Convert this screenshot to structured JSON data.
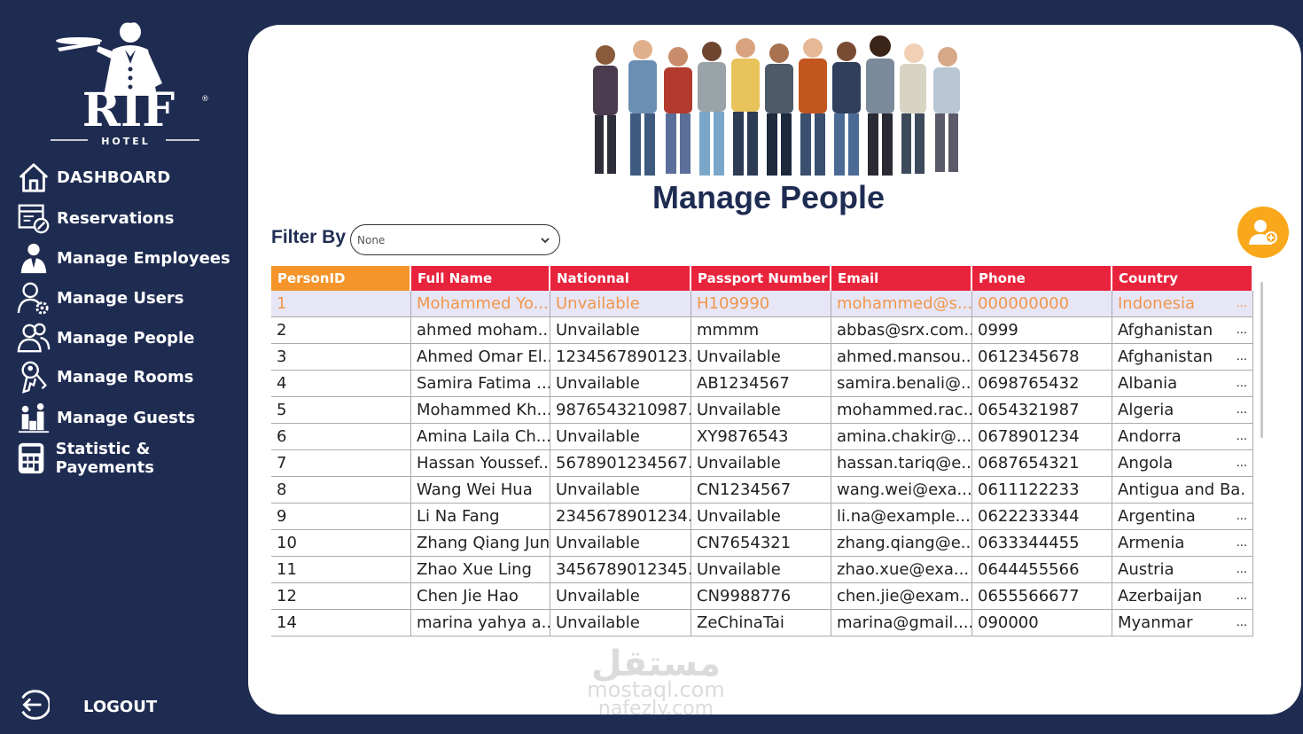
{
  "sidebar": {
    "logo": {
      "brand": "RIF",
      "sub": "HOTEL",
      "mark": "®"
    },
    "items": [
      {
        "label": "DASHBOARD",
        "icon": "home-icon"
      },
      {
        "label": "Reservations",
        "icon": "calendar-icon"
      },
      {
        "label": "Manage Employees",
        "icon": "employee-icon"
      },
      {
        "label": "Manage Users",
        "icon": "user-gear-icon"
      },
      {
        "label": "Manage People",
        "icon": "people-icon"
      },
      {
        "label": "Manage Rooms",
        "icon": "key-icon"
      },
      {
        "label": "Manage Guests",
        "icon": "guests-icon"
      },
      {
        "label": "Statistic & Payements",
        "icon": "calculator-icon"
      }
    ],
    "logout_label": "LOGOUT"
  },
  "main": {
    "title": "Manage People",
    "filter_label": "Filter By",
    "filter_value": "None"
  },
  "table": {
    "columns": [
      "PersonID",
      "Full Name",
      "Nationnal",
      "Passport Number",
      "Email",
      "Phone",
      "Country"
    ],
    "rows": [
      [
        "1",
        "Mohammed Yo...",
        "Unvailable",
        "H109990",
        "mohammed@s...",
        "000000000",
        "Indonesia"
      ],
      [
        "2",
        "ahmed moham...",
        "Unvailable",
        "mmmm",
        "abbas@srx.com...",
        "0999",
        "Afghanistan"
      ],
      [
        "3",
        "Ahmed Omar El...",
        "1234567890123...",
        "Unvailable",
        "ahmed.mansou...",
        "0612345678",
        "Afghanistan"
      ],
      [
        "4",
        "Samira Fatima ...",
        "Unvailable",
        "AB1234567",
        "samira.benali@...",
        "0698765432",
        "Albania"
      ],
      [
        "5",
        "Mohammed Kh...",
        "9876543210987...",
        "Unvailable",
        "mohammed.rac...",
        "0654321987",
        "Algeria"
      ],
      [
        "6",
        "Amina Laila Ch...",
        "Unvailable",
        "XY9876543",
        "amina.chakir@...",
        "0678901234",
        "Andorra"
      ],
      [
        "7",
        "Hassan Youssef...",
        "5678901234567...",
        "Unvailable",
        "hassan.tariq@e...",
        "0687654321",
        "Angola"
      ],
      [
        "8",
        "Wang Wei Hua",
        "Unvailable",
        "CN1234567",
        "wang.wei@exa...",
        "0611122233",
        "Antigua and Ba..."
      ],
      [
        "9",
        "Li Na Fang",
        "2345678901234...",
        "Unvailable",
        "li.na@example....",
        "0622233344",
        "Argentina"
      ],
      [
        "10",
        "Zhang Qiang Jun",
        "Unvailable",
        "CN7654321",
        "zhang.qiang@e...",
        "0633344455",
        "Armenia"
      ],
      [
        "11",
        "Zhao Xue Ling",
        "3456789012345...",
        "Unvailable",
        "zhao.xue@exa...",
        "0644455566",
        "Austria"
      ],
      [
        "12",
        "Chen Jie Hao",
        "Unvailable",
        "CN9988776",
        "chen.jie@exam...",
        "0655566677",
        "Azerbaijan"
      ],
      [
        "14",
        "marina yahya a...",
        "Unvailable",
        "ZeChinaTai",
        "marina@gmail....",
        "090000",
        "Myanmar"
      ]
    ],
    "row_suffix": [
      "...",
      "...",
      "...",
      "...",
      "...",
      "...",
      "...",
      "",
      "...",
      "...",
      "...",
      "...",
      "..."
    ]
  },
  "watermark": {
    "line1": "مستقل",
    "line2": "mostaql.com",
    "line3": "nafezly.com"
  },
  "colors": {
    "navy": "#1f2c52",
    "header_red": "#e8243c",
    "header_orange": "#f4942a",
    "accent_orange": "#f9a81b",
    "selected_bg": "#e7e6f7",
    "selected_text": "#f0964a"
  }
}
